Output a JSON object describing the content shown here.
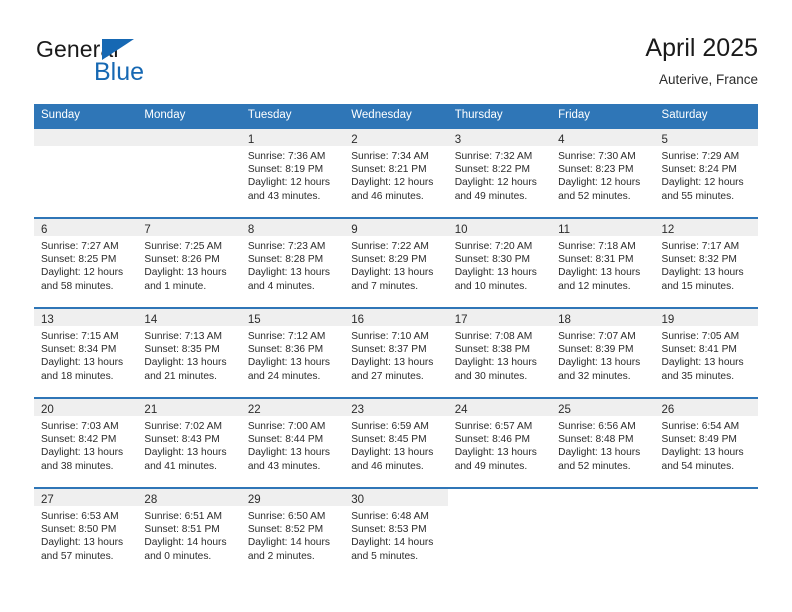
{
  "brand": {
    "word1": "General",
    "word2": "Blue",
    "flag_icon": "triangle-flag-icon",
    "accent_color": "#1668b3"
  },
  "header": {
    "title": "April 2025",
    "location": "Auterive, France"
  },
  "calendar": {
    "header_bg": "#2f76b7",
    "daynum_strip_bg": "#efefef",
    "weekday_labels": [
      "Sunday",
      "Monday",
      "Tuesday",
      "Wednesday",
      "Thursday",
      "Friday",
      "Saturday"
    ],
    "weeks": [
      [
        {
          "day": "",
          "empty": true,
          "lines": []
        },
        {
          "day": "",
          "empty": true,
          "lines": []
        },
        {
          "day": "1",
          "lines": [
            "Sunrise: 7:36 AM",
            "Sunset: 8:19 PM",
            "Daylight: 12 hours and 43 minutes."
          ]
        },
        {
          "day": "2",
          "lines": [
            "Sunrise: 7:34 AM",
            "Sunset: 8:21 PM",
            "Daylight: 12 hours and 46 minutes."
          ]
        },
        {
          "day": "3",
          "lines": [
            "Sunrise: 7:32 AM",
            "Sunset: 8:22 PM",
            "Daylight: 12 hours and 49 minutes."
          ]
        },
        {
          "day": "4",
          "lines": [
            "Sunrise: 7:30 AM",
            "Sunset: 8:23 PM",
            "Daylight: 12 hours and 52 minutes."
          ]
        },
        {
          "day": "5",
          "lines": [
            "Sunrise: 7:29 AM",
            "Sunset: 8:24 PM",
            "Daylight: 12 hours and 55 minutes."
          ]
        }
      ],
      [
        {
          "day": "6",
          "lines": [
            "Sunrise: 7:27 AM",
            "Sunset: 8:25 PM",
            "Daylight: 12 hours and 58 minutes."
          ]
        },
        {
          "day": "7",
          "lines": [
            "Sunrise: 7:25 AM",
            "Sunset: 8:26 PM",
            "Daylight: 13 hours and 1 minute."
          ]
        },
        {
          "day": "8",
          "lines": [
            "Sunrise: 7:23 AM",
            "Sunset: 8:28 PM",
            "Daylight: 13 hours and 4 minutes."
          ]
        },
        {
          "day": "9",
          "lines": [
            "Sunrise: 7:22 AM",
            "Sunset: 8:29 PM",
            "Daylight: 13 hours and 7 minutes."
          ]
        },
        {
          "day": "10",
          "lines": [
            "Sunrise: 7:20 AM",
            "Sunset: 8:30 PM",
            "Daylight: 13 hours and 10 minutes."
          ]
        },
        {
          "day": "11",
          "lines": [
            "Sunrise: 7:18 AM",
            "Sunset: 8:31 PM",
            "Daylight: 13 hours and 12 minutes."
          ]
        },
        {
          "day": "12",
          "lines": [
            "Sunrise: 7:17 AM",
            "Sunset: 8:32 PM",
            "Daylight: 13 hours and 15 minutes."
          ]
        }
      ],
      [
        {
          "day": "13",
          "lines": [
            "Sunrise: 7:15 AM",
            "Sunset: 8:34 PM",
            "Daylight: 13 hours and 18 minutes."
          ]
        },
        {
          "day": "14",
          "lines": [
            "Sunrise: 7:13 AM",
            "Sunset: 8:35 PM",
            "Daylight: 13 hours and 21 minutes."
          ]
        },
        {
          "day": "15",
          "lines": [
            "Sunrise: 7:12 AM",
            "Sunset: 8:36 PM",
            "Daylight: 13 hours and 24 minutes."
          ]
        },
        {
          "day": "16",
          "lines": [
            "Sunrise: 7:10 AM",
            "Sunset: 8:37 PM",
            "Daylight: 13 hours and 27 minutes."
          ]
        },
        {
          "day": "17",
          "lines": [
            "Sunrise: 7:08 AM",
            "Sunset: 8:38 PM",
            "Daylight: 13 hours and 30 minutes."
          ]
        },
        {
          "day": "18",
          "lines": [
            "Sunrise: 7:07 AM",
            "Sunset: 8:39 PM",
            "Daylight: 13 hours and 32 minutes."
          ]
        },
        {
          "day": "19",
          "lines": [
            "Sunrise: 7:05 AM",
            "Sunset: 8:41 PM",
            "Daylight: 13 hours and 35 minutes."
          ]
        }
      ],
      [
        {
          "day": "20",
          "lines": [
            "Sunrise: 7:03 AM",
            "Sunset: 8:42 PM",
            "Daylight: 13 hours and 38 minutes."
          ]
        },
        {
          "day": "21",
          "lines": [
            "Sunrise: 7:02 AM",
            "Sunset: 8:43 PM",
            "Daylight: 13 hours and 41 minutes."
          ]
        },
        {
          "day": "22",
          "lines": [
            "Sunrise: 7:00 AM",
            "Sunset: 8:44 PM",
            "Daylight: 13 hours and 43 minutes."
          ]
        },
        {
          "day": "23",
          "lines": [
            "Sunrise: 6:59 AM",
            "Sunset: 8:45 PM",
            "Daylight: 13 hours and 46 minutes."
          ]
        },
        {
          "day": "24",
          "lines": [
            "Sunrise: 6:57 AM",
            "Sunset: 8:46 PM",
            "Daylight: 13 hours and 49 minutes."
          ]
        },
        {
          "day": "25",
          "lines": [
            "Sunrise: 6:56 AM",
            "Sunset: 8:48 PM",
            "Daylight: 13 hours and 52 minutes."
          ]
        },
        {
          "day": "26",
          "lines": [
            "Sunrise: 6:54 AM",
            "Sunset: 8:49 PM",
            "Daylight: 13 hours and 54 minutes."
          ]
        }
      ],
      [
        {
          "day": "27",
          "lines": [
            "Sunrise: 6:53 AM",
            "Sunset: 8:50 PM",
            "Daylight: 13 hours and 57 minutes."
          ]
        },
        {
          "day": "28",
          "lines": [
            "Sunrise: 6:51 AM",
            "Sunset: 8:51 PM",
            "Daylight: 14 hours and 0 minutes."
          ]
        },
        {
          "day": "29",
          "lines": [
            "Sunrise: 6:50 AM",
            "Sunset: 8:52 PM",
            "Daylight: 14 hours and 2 minutes."
          ]
        },
        {
          "day": "30",
          "lines": [
            "Sunrise: 6:48 AM",
            "Sunset: 8:53 PM",
            "Daylight: 14 hours and 5 minutes."
          ]
        },
        {
          "day": "",
          "blank": true,
          "lines": []
        },
        {
          "day": "",
          "blank": true,
          "lines": []
        },
        {
          "day": "",
          "blank": true,
          "lines": []
        }
      ]
    ]
  }
}
